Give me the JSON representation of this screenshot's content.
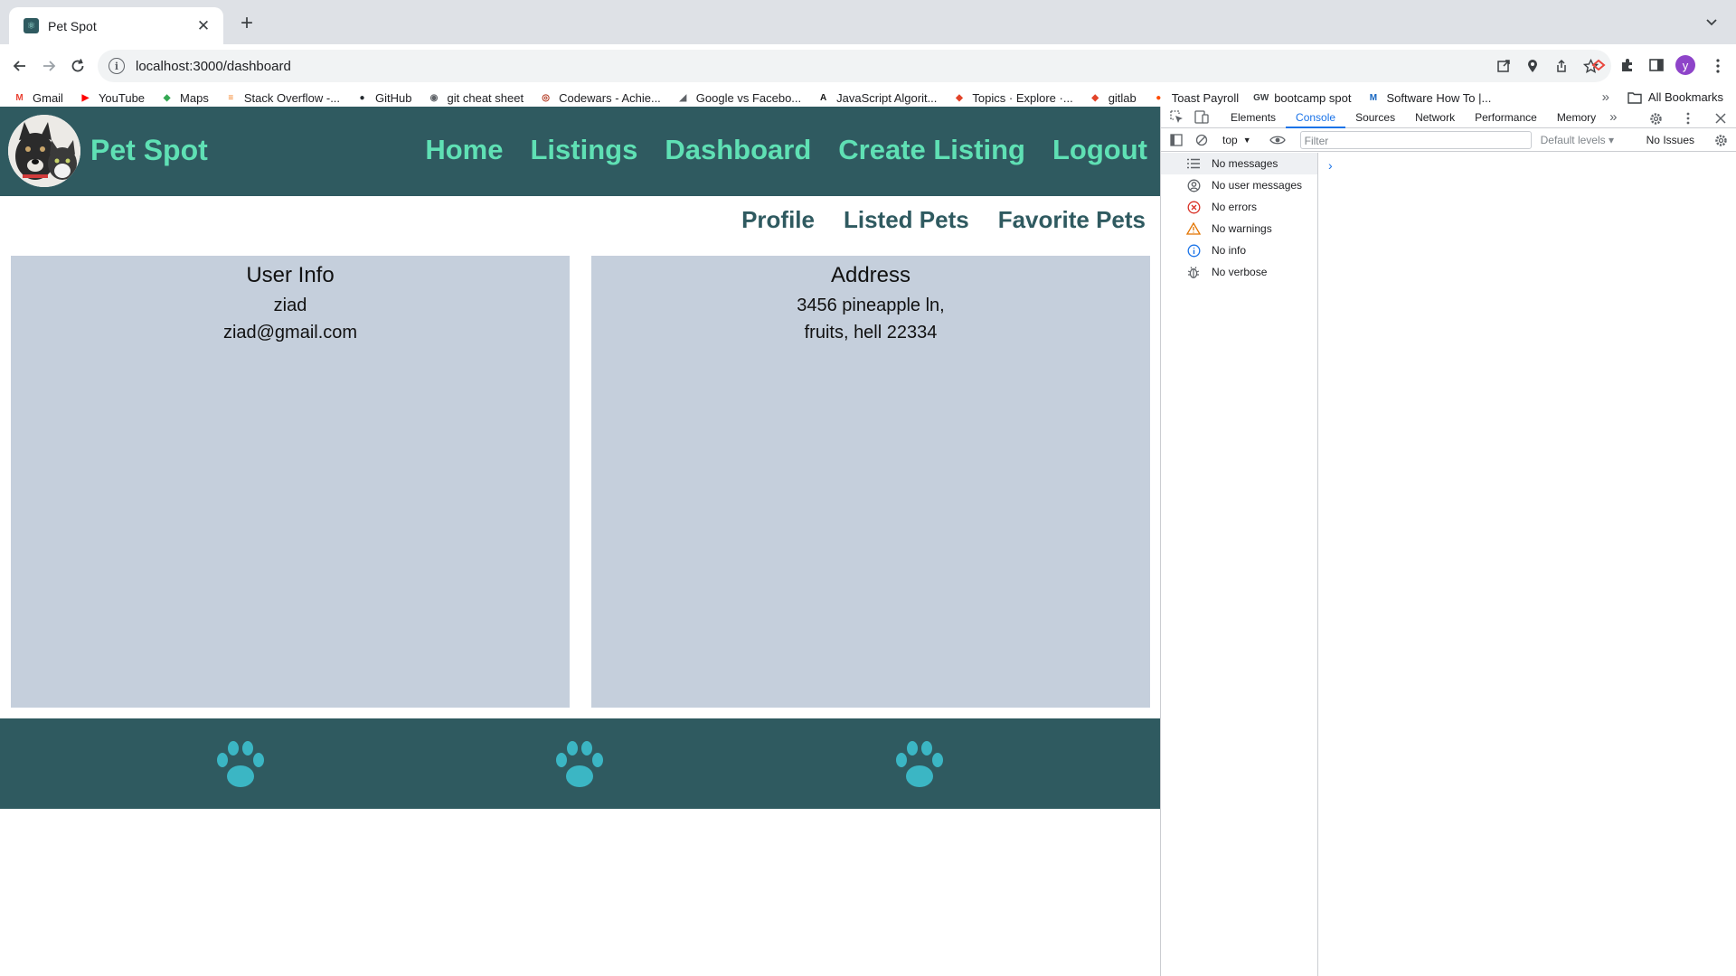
{
  "browser": {
    "tab_title": "Pet Spot",
    "new_tab": "+",
    "url": "localhost:3000/dashboard",
    "profile_initial": "y",
    "bookmarks": [
      {
        "label": "Gmail",
        "icon": "gmail-icon",
        "color": "#ea4335",
        "glyph": "M"
      },
      {
        "label": "YouTube",
        "icon": "youtube-icon",
        "color": "#ff0000",
        "glyph": "▶"
      },
      {
        "label": "Maps",
        "icon": "maps-icon",
        "color": "#34a853",
        "glyph": "◆"
      },
      {
        "label": "Stack Overflow -...",
        "icon": "stackoverflow-icon",
        "color": "#f48024",
        "glyph": "≡"
      },
      {
        "label": "GitHub",
        "icon": "github-icon",
        "color": "#24292e",
        "glyph": "●"
      },
      {
        "label": "git cheat sheet",
        "icon": "globe-icon",
        "color": "#5f6368",
        "glyph": "◉"
      },
      {
        "label": "Codewars - Achie...",
        "icon": "codewars-icon",
        "color": "#b1361e",
        "glyph": "◎"
      },
      {
        "label": "Google vs Facebo...",
        "icon": "chart-icon",
        "color": "#5f6368",
        "glyph": "◢"
      },
      {
        "label": "JavaScript Algorit...",
        "icon": "js-icon",
        "color": "#111111",
        "glyph": "A"
      },
      {
        "label": "Topics · Explore ·...",
        "icon": "gitlab-icon",
        "color": "#e24329",
        "glyph": "◆"
      },
      {
        "label": "gitlab",
        "icon": "gitlab-icon",
        "color": "#e24329",
        "glyph": "◆"
      },
      {
        "label": "Toast Payroll",
        "icon": "toast-icon",
        "color": "#ff4c00",
        "glyph": "●"
      },
      {
        "label": "bootcamp spot",
        "icon": "gw-icon",
        "color": "#3c4043",
        "glyph": "GW"
      },
      {
        "label": "Software How To |...",
        "icon": "medium-icon",
        "color": "#1565c0",
        "glyph": "M"
      }
    ],
    "more_bookmarks": "»",
    "all_bookmarks": "All Bookmarks"
  },
  "site": {
    "brand": "Pet Spot",
    "nav": [
      "Home",
      "Listings",
      "Dashboard",
      "Create Listing",
      "Logout"
    ],
    "subnav": [
      "Profile",
      "Listed Pets",
      "Favorite Pets"
    ],
    "user_info": {
      "title": "User Info",
      "name": "ziad",
      "email": "ziad@gmail.com"
    },
    "address": {
      "title": "Address",
      "line1": "3456 pineapple ln,",
      "line2": "fruits, hell 22334"
    },
    "colors": {
      "header": "#2f5a60",
      "nav_text": "#5fe0b4",
      "card": "#c5cfdc",
      "paw": "#3bb6c4"
    }
  },
  "devtools": {
    "tabs": [
      "Elements",
      "Console",
      "Sources",
      "Network",
      "Performance",
      "Memory"
    ],
    "active_tab": "Console",
    "more_tabs": "»",
    "context": "top",
    "filter_placeholder": "Filter",
    "levels": "Default levels ▾",
    "issues": "No Issues",
    "sidebar": [
      {
        "label": "No messages",
        "icon": "list-icon"
      },
      {
        "label": "No user messages",
        "icon": "user-icon"
      },
      {
        "label": "No errors",
        "icon": "error-icon"
      },
      {
        "label": "No warnings",
        "icon": "warning-icon"
      },
      {
        "label": "No info",
        "icon": "info-icon"
      },
      {
        "label": "No verbose",
        "icon": "bug-icon"
      }
    ],
    "prompt": "›"
  }
}
